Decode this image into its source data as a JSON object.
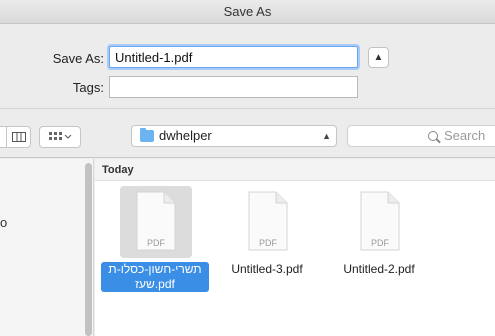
{
  "window": {
    "title": "Save As"
  },
  "form": {
    "save_as_label": "Save As:",
    "save_as_value": "Untitled-1.pdf",
    "tags_label": "Tags:",
    "tags_value": "",
    "expand_icon": "chevron-up-icon"
  },
  "toolbar": {
    "view_icon": "column-view-icon",
    "arrange_icon": "arrange-grid-icon",
    "location": "dwhelper",
    "location_icon": "folder-icon",
    "search_placeholder": "Search"
  },
  "sidebar": {
    "stub_text": "o"
  },
  "content": {
    "section_title": "Today",
    "files": [
      {
        "line1": "תשרי-חשון-כסלו-ת",
        "line2": "pdf.שעז",
        "type_label": "PDF",
        "selected": true
      },
      {
        "line1": "Untitled-3.pdf",
        "type_label": "PDF",
        "selected": false
      },
      {
        "line1": "Untitled-2.pdf",
        "type_label": "PDF",
        "selected": false
      }
    ]
  }
}
